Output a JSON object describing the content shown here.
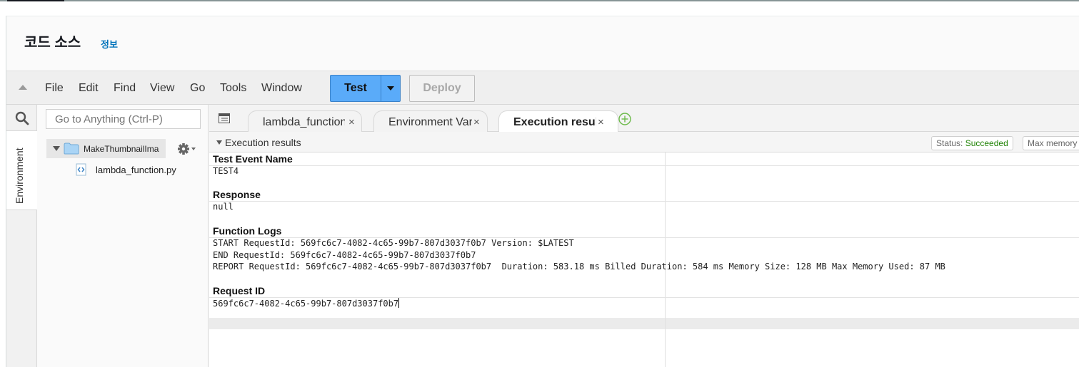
{
  "header": {
    "title": "코드 소스",
    "info_link": "정보"
  },
  "menubar": {
    "items": [
      "File",
      "Edit",
      "Find",
      "View",
      "Go",
      "Tools",
      "Window"
    ],
    "test_label": "Test",
    "deploy_label": "Deploy"
  },
  "sidebar": {
    "environment_tab": "Environment",
    "goto_placeholder": "Go to Anything (Ctrl-P)"
  },
  "tree": {
    "folder": "MakeThumbnailIma",
    "file": "lambda_function.py"
  },
  "tabs": [
    {
      "label": "lambda_function",
      "close": "×"
    },
    {
      "label": "Environment Vari",
      "close": "×"
    },
    {
      "label": "Execution results",
      "close": "×"
    }
  ],
  "results": {
    "section_title": "Execution results",
    "status_label": "Status:",
    "status_value": "Succeeded",
    "max_memory_label": "Max memory u",
    "test_event_heading": "Test Event Name",
    "test_event_value": "TEST4",
    "response_heading": "Response",
    "response_value": "null",
    "logs_heading": "Function Logs",
    "log_lines": [
      "START RequestId: 569fc6c7-4082-4c65-99b7-807d3037f0b7 Version: $LATEST",
      "END RequestId: 569fc6c7-4082-4c65-99b7-807d3037f0b7",
      "REPORT RequestId: 569fc6c7-4082-4c65-99b7-807d3037f0b7  Duration: 583.18 ms Billed Duration: 584 ms Memory Size: 128 MB Max Memory Used: 87 MB"
    ],
    "request_id_heading": "Request ID",
    "request_id_value": "569fc6c7-4082-4c65-99b7-807d3037f0b7"
  },
  "colors": {
    "test_button": "#5aabf9",
    "status_success": "#1d8102",
    "info_link": "#0073bb"
  }
}
